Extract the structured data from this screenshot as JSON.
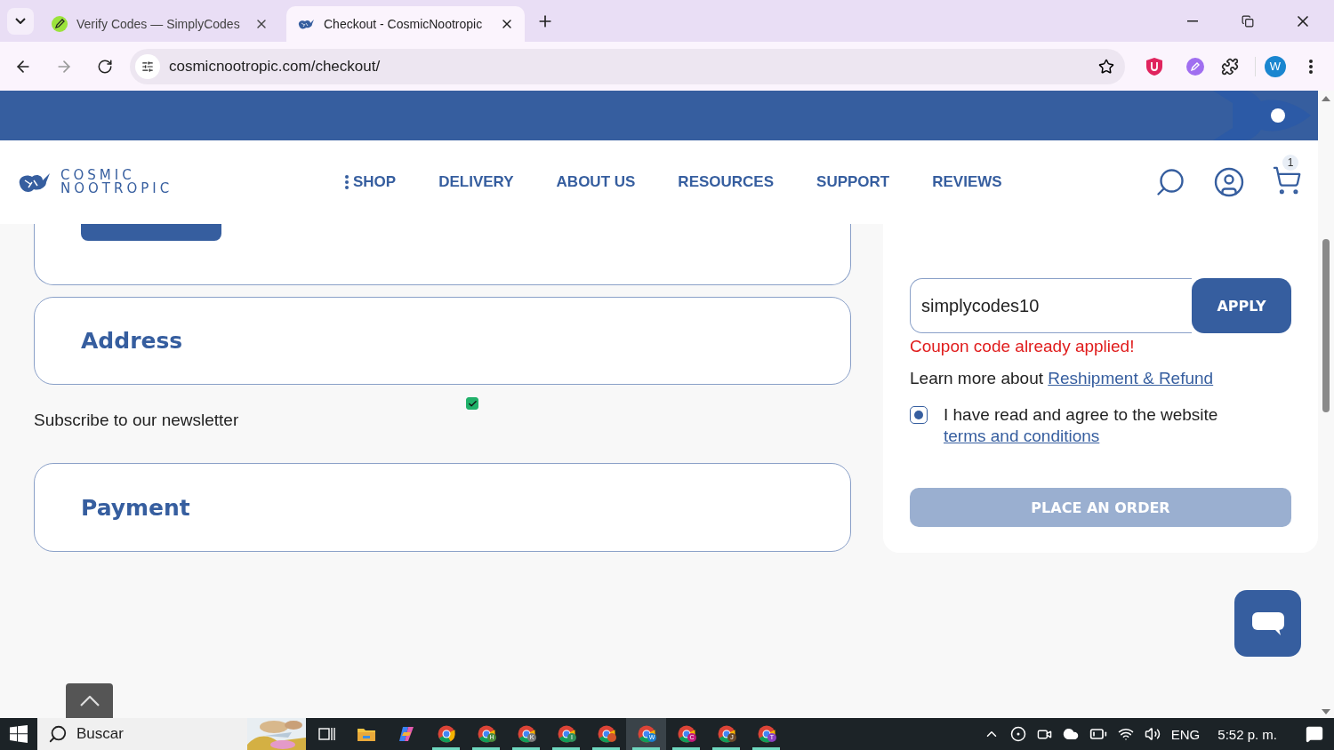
{
  "browser": {
    "tabs": [
      {
        "title": "Verify Codes — SimplyCodes",
        "selected": false
      },
      {
        "title": "Checkout - CosmicNootropic",
        "selected": true
      }
    ],
    "url": "cosmicnootropic.com/checkout/",
    "profile_initial": "W"
  },
  "site": {
    "logo_line_1": "COSMIC",
    "logo_line_2": "NOOTROPIC",
    "nav": [
      "SHOP",
      "DELIVERY",
      "ABOUT US",
      "RESOURCES",
      "SUPPORT",
      "REVIEWS"
    ],
    "cart_count": "1"
  },
  "checkout": {
    "sections": [
      {
        "title": "Address"
      },
      {
        "title": "Payment"
      }
    ],
    "newsletter": {
      "label": "Subscribe to our newsletter",
      "checked": true
    },
    "coupon": {
      "value": "simplycodes10",
      "button": "APPLY",
      "error": "Coupon code already applied!"
    },
    "learn_more": {
      "text": "Learn more about",
      "link": "Reshipment & Refund"
    },
    "terms": {
      "text": "I have read and agree to the website",
      "link": "terms and conditions",
      "checked": true
    },
    "place_order": {
      "label": "PLACE AN ORDER",
      "disabled": true
    }
  },
  "taskbar": {
    "search_placeholder": "Buscar",
    "apps": [
      {
        "kind": "taskview",
        "running": false,
        "selected": false
      },
      {
        "kind": "explorer",
        "running": false,
        "selected": false
      },
      {
        "kind": "copilot",
        "running": false,
        "selected": false
      },
      {
        "kind": "chrome",
        "running": true,
        "selected": false
      },
      {
        "kind": "chrome",
        "badge": "H",
        "color": "#4a8a3c",
        "running": true,
        "selected": false
      },
      {
        "kind": "chrome",
        "badge": "K",
        "color": "#7a7a7a",
        "running": true,
        "selected": false
      },
      {
        "kind": "chrome",
        "badge": "I",
        "color": "#2f8f5a",
        "running": true,
        "selected": false
      },
      {
        "kind": "chrome",
        "color": "#d2552b",
        "running": true,
        "selected": false
      },
      {
        "kind": "chrome",
        "badge": "W",
        "color": "#1a7fd0",
        "running": true,
        "selected": true
      },
      {
        "kind": "chrome",
        "badge": "C",
        "color": "#c2187a",
        "running": true,
        "selected": false
      },
      {
        "kind": "chrome",
        "badge": "J",
        "color": "#6b4a2a",
        "running": true,
        "selected": false
      },
      {
        "kind": "chrome",
        "badge": "T",
        "color": "#8a3fc0",
        "running": true,
        "selected": false
      }
    ],
    "language": "ENG",
    "time": "5:52 p. m."
  }
}
